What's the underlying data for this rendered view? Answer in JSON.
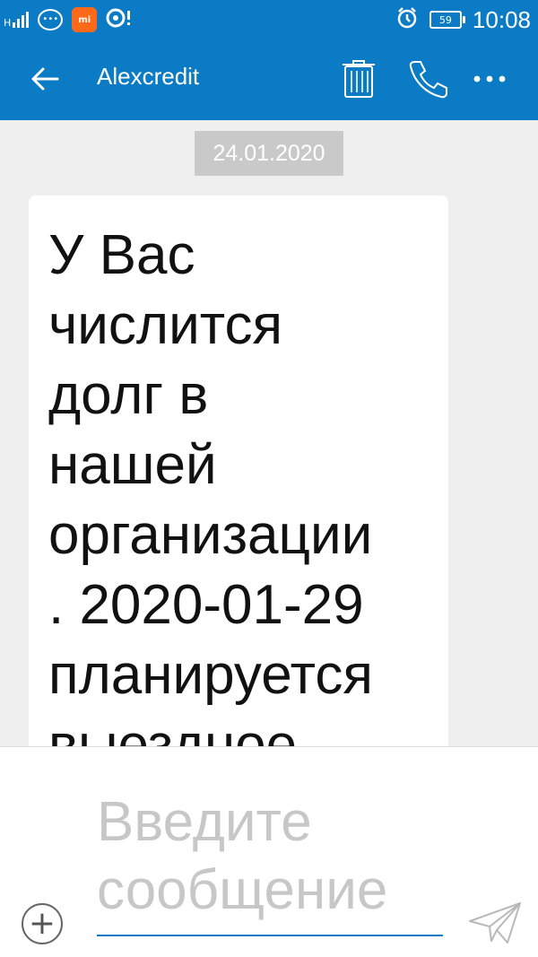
{
  "status_bar": {
    "signal_label": "H",
    "battery_level": "59",
    "time": "10:08",
    "mi_badge": "mi",
    "icons": [
      "signal-icon",
      "chat-bubble-icon",
      "mi-app-icon",
      "notification-icon",
      "alarm-icon",
      "battery-icon"
    ]
  },
  "header": {
    "title": "Alexcredit",
    "actions": [
      "delete-icon",
      "phone-icon",
      "more-icon"
    ]
  },
  "conversation": {
    "date": "24.01.2020",
    "message_text": "У Вас\nчислится\nдолг в\nнашей\nорганизации\n. 2020-01-29\nпланируется\nвыездное"
  },
  "composer": {
    "placeholder": "Введите\nсообщение"
  },
  "colors": {
    "primary": "#0b7bc5",
    "background": "#efefef",
    "date_chip": "#c9c9c9",
    "placeholder": "#c7c7c7"
  }
}
